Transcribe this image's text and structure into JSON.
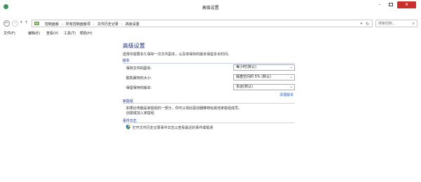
{
  "window": {
    "title": "高级设置",
    "minimize": "–",
    "close": "×"
  },
  "nav": {
    "back": "←",
    "forward": "→",
    "dropdown": "▾",
    "up": "↑",
    "breadcrumbs": [
      "控制面板",
      "所有控制面板项",
      "文件历史记录",
      "高级设置"
    ],
    "separator": "›",
    "refresh": "↻",
    "search_placeholder": "搜索控制...",
    "search_icon": "⌕"
  },
  "menu": {
    "items": [
      "文件(F)",
      "编辑(E)",
      "查看(V)",
      "工具(T)",
      "帮助(H)"
    ]
  },
  "main": {
    "title": "高级设置",
    "description": "选择你需要多久保存一次文件副本，以及将保存的版本保留多长时间。",
    "versions": {
      "heading": "版本",
      "rows": [
        {
          "label": "保存文件的副本:",
          "value": "每小时(默认)"
        },
        {
          "label": "脱机缓存的大小:",
          "value": "磁盘空间的 5% (默认)"
        },
        {
          "label": "保留保存的版本:",
          "value": "永远(默认)"
        }
      ],
      "cleanup_link": "清理版本"
    },
    "homegroup": {
      "heading": "家庭组",
      "text": "如果此电脑是家庭组的一部分，你可以将此驱动器推荐给其他家庭组成员。",
      "link": "创建或加入家庭组"
    },
    "eventlog": {
      "heading": "事件日志",
      "link": "打开文件历史记录事件日志以查看最近的事件或错误"
    }
  }
}
